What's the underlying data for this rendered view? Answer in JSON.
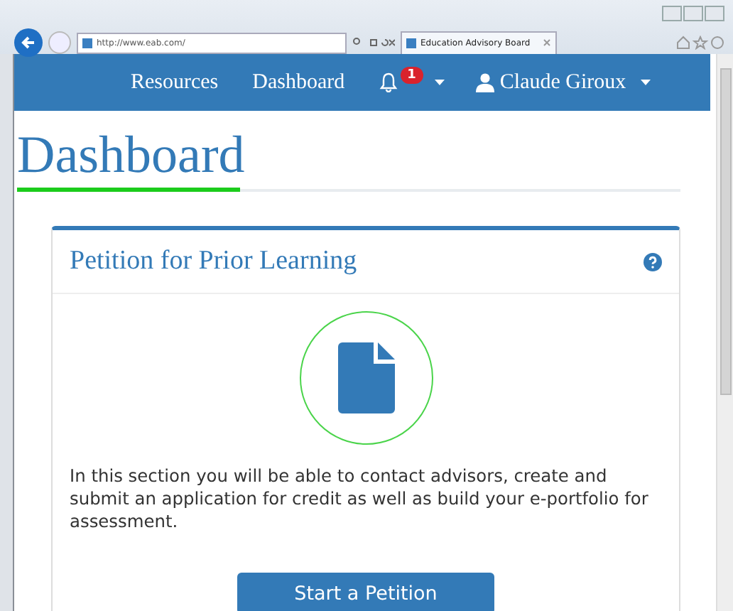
{
  "browser": {
    "address": "http://www.eab.com/",
    "tab_title": "Education Advisory Board"
  },
  "nav": {
    "links": [
      {
        "label": "Resources"
      },
      {
        "label": "Dashboard"
      }
    ],
    "notifications": {
      "count": "1"
    },
    "user": {
      "name": "Claude Giroux"
    }
  },
  "page": {
    "title": "Dashboard"
  },
  "panel": {
    "title": "Petition for Prior Learning",
    "description": "In this section you will be able to contact advisors, create and submit an application for credit as well as build your e-portfolio for assessment.",
    "button": "Start a Petition"
  }
}
